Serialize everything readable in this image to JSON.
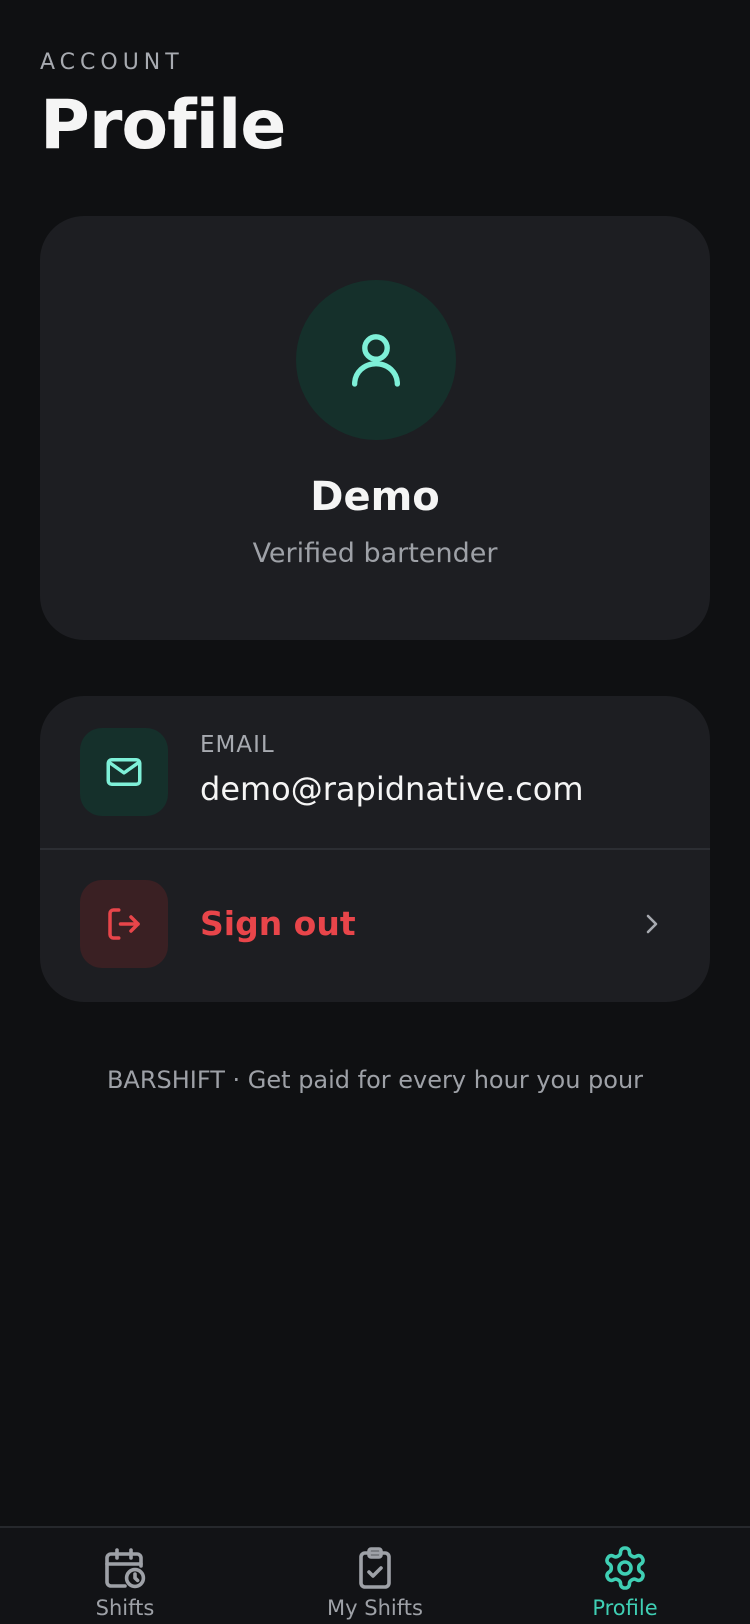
{
  "header": {
    "section_label": "ACCOUNT",
    "title": "Profile"
  },
  "profile": {
    "name": "Demo",
    "role": "Verified bartender",
    "avatar_icon": "user-icon"
  },
  "details": {
    "email_label": "EMAIL",
    "email_value": "demo@rapidnative.com",
    "email_icon": "mail-icon",
    "signout_label": "Sign out",
    "signout_icon": "logout-icon"
  },
  "footer": {
    "tagline": "BARSHIFT · Get paid for every hour you pour"
  },
  "tabs": [
    {
      "label": "Shifts",
      "icon": "calendar-clock-icon",
      "active": false
    },
    {
      "label": "My Shifts",
      "icon": "clipboard-check-icon",
      "active": false
    },
    {
      "label": "Profile",
      "icon": "gear-icon",
      "active": true
    }
  ],
  "colors": {
    "background": "#0f1012",
    "card": "#1d1e22",
    "accent": "#3fcfb4",
    "accent_light": "#7ef0d8",
    "danger": "#e8454a",
    "muted_text": "#9ea1a7"
  }
}
